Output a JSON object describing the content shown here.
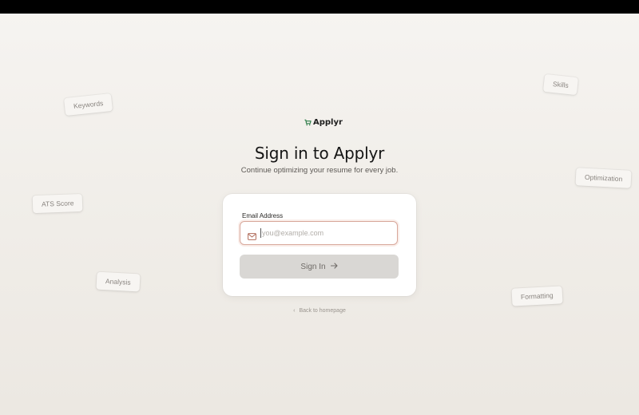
{
  "brand": {
    "name": "Applyr",
    "icon": "cart-icon",
    "accent": "#2f7d4a"
  },
  "heading": {
    "title": "Sign in to Applyr",
    "subtitle": "Continue optimizing your resume for every job."
  },
  "form": {
    "email_label": "Email Address",
    "email_placeholder": "you@example.com",
    "email_value": "",
    "submit_label": "Sign In"
  },
  "back_link": "Back to homepage",
  "tags": {
    "keywords": "Keywords",
    "skills": "Skills",
    "ats": "ATS Score",
    "optimization": "Optimization",
    "analysis": "Analysis",
    "formatting": "Formatting"
  },
  "colors": {
    "field_border": "#d8a79a",
    "button_bg": "#d9d7d4",
    "button_text": "#6f6b67"
  }
}
